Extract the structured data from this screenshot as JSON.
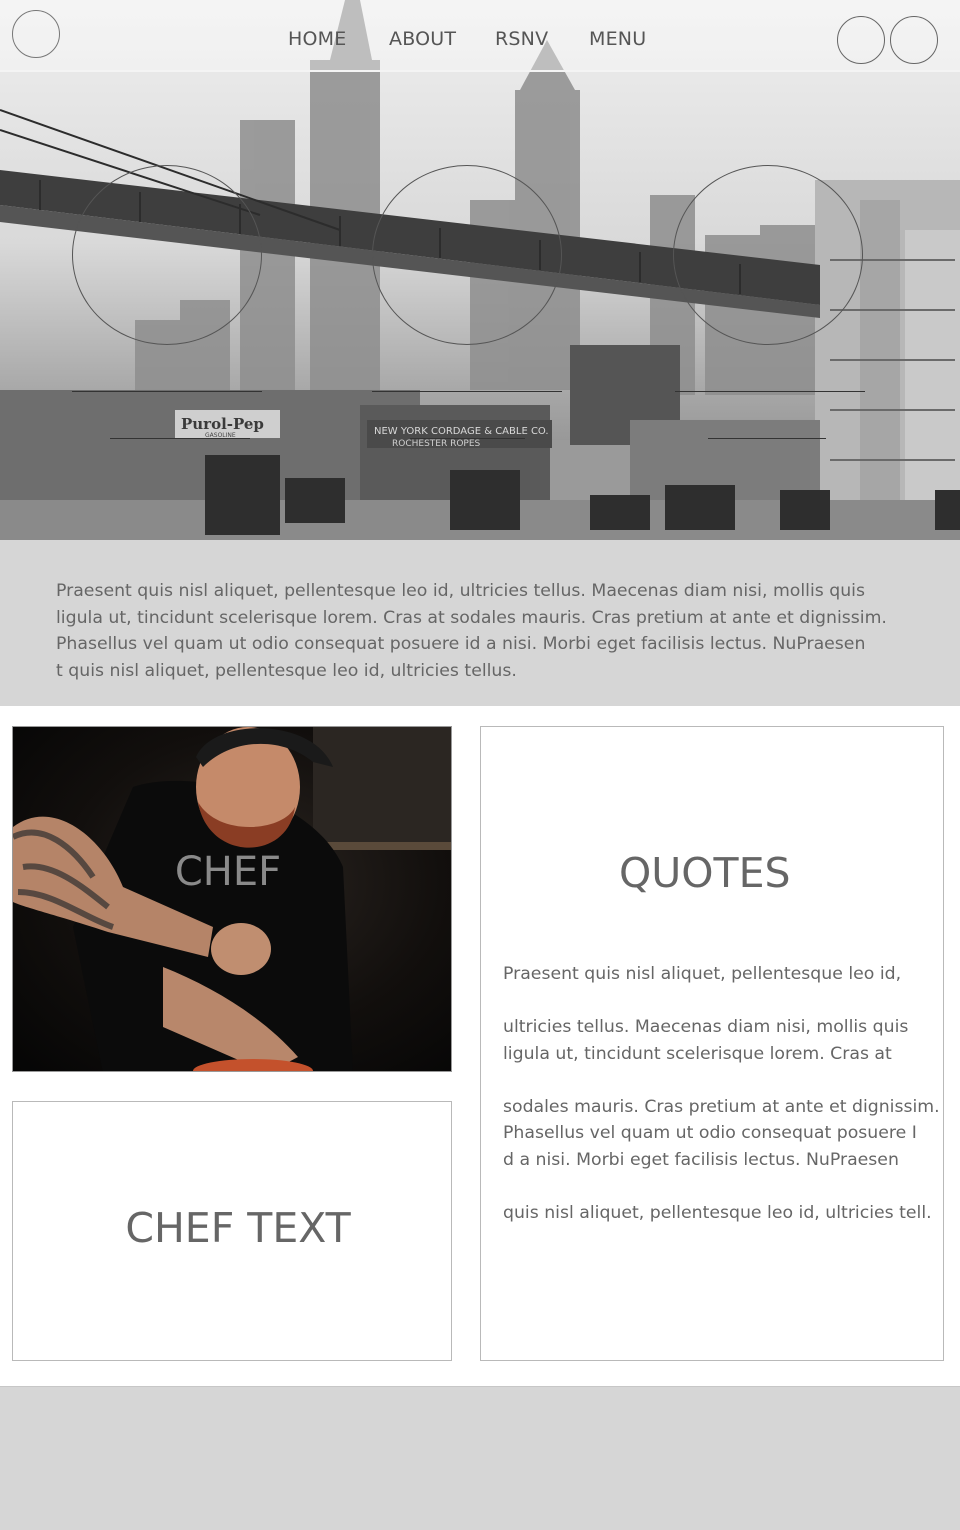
{
  "nav": {
    "items": [
      {
        "label": "HOME"
      },
      {
        "label": "ABOUT"
      },
      {
        "label": "RSNV"
      },
      {
        "label": "MENU"
      }
    ]
  },
  "hero": {
    "image_icon": "city-skyline-photo",
    "sign_left": "Purol-Pep",
    "sign_left_sub": "GASOLINE",
    "sign_right": "NEW YORK CORDAGE & CABLE CO.",
    "sign_right_sub": "ROCHESTER ROPES"
  },
  "intro": {
    "text": "Praesent quis nisl aliquet, pellentesque leo id, ultricies tellus. Maecenas diam nisi, mollis quis\n ligula ut, tincidunt scelerisque lorem. Cras at sodales mauris. Cras pretium at ante et dignissim.\n Phasellus vel quam ut odio consequat posuere id a nisi. Morbi eget facilisis lectus. NuPraesen\nt quis nisl aliquet, pellentesque leo id, ultricies tellus."
  },
  "chef": {
    "label": "CHEF",
    "image_icon": "chef-photo"
  },
  "chef_text": {
    "title": "CHEF TEXT"
  },
  "quotes": {
    "title": "QUOTES",
    "body": "Praesent quis nisl aliquet, pellentesque leo id,\n\nultricies tellus. Maecenas diam nisi, mollis quis\n ligula ut, tincidunt scelerisque lorem. Cras at\n\nsodales mauris. Cras pretium at ante et dignissim.\n Phasellus vel quam ut odio consequat posuere I\nd a nisi. Morbi eget facilisis lectus. NuPraesen\n\nquis nisl aliquet, pellentesque leo id, ultricies tell."
  },
  "colors": {
    "band_gray": "#d6d6d6",
    "text_gray": "#666666",
    "border_gray": "#b9b9b9"
  }
}
